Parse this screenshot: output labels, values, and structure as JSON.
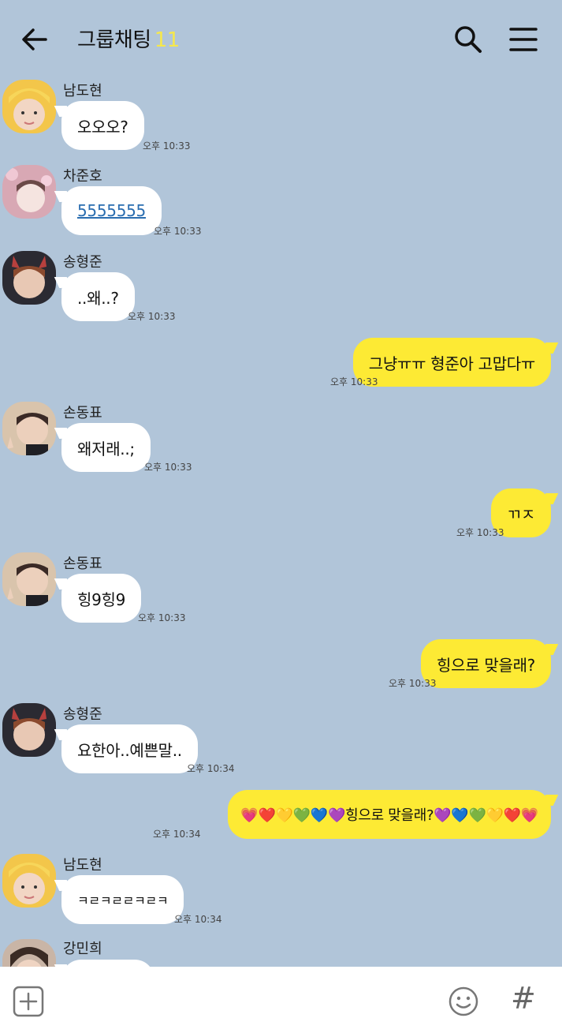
{
  "header": {
    "title": "그룹채팅",
    "member_count": "11",
    "count_color": "#f6e84b"
  },
  "colors": {
    "background": "#b1c5d9",
    "incoming": "#ffffff",
    "outgoing": "#fdea34",
    "link": "#2a6db0"
  },
  "messages": [
    {
      "sender": "남도현",
      "text": "오오오?",
      "time": "오후 10:33",
      "direction": "in",
      "avatar_icon": "chick-hat-avatar"
    },
    {
      "sender": "차준호",
      "text": "5555555",
      "time": "오후 10:33",
      "direction": "in",
      "is_link": true,
      "avatar_icon": "flower-avatar"
    },
    {
      "sender": "송형준",
      "text": "..왜..?",
      "time": "오후 10:33",
      "direction": "in",
      "avatar_icon": "devil-horn-avatar"
    },
    {
      "text": "그냥ㅠㅠ 형준아 고맙다ㅠ",
      "time": "오후 10:33",
      "direction": "out"
    },
    {
      "sender": "손동표",
      "text": "왜저래..;",
      "time": "오후 10:33",
      "direction": "in",
      "avatar_icon": "peace-sign-avatar"
    },
    {
      "text": "ㄲㅈ",
      "time": "오후 10:33",
      "direction": "out"
    },
    {
      "sender": "손동표",
      "text": "힝9힝9",
      "time": "오후 10:33",
      "direction": "in",
      "avatar_icon": "peace-sign-avatar"
    },
    {
      "text": "힝으로 맞을래?",
      "time": "오후 10:33",
      "direction": "out"
    },
    {
      "sender": "송형준",
      "text": "요한아..예쁜말..",
      "time": "오후 10:34",
      "direction": "in",
      "avatar_icon": "devil-horn-avatar"
    },
    {
      "text": "💗❤️💛💚💙💜힝으로 맞을래?💜💙💚💛❤️💗",
      "time": "오후 10:34",
      "direction": "out"
    },
    {
      "sender": "남도현",
      "text": "ㅋㄹㅋㄹㄹㅋㄹㅋ",
      "time": "오후 10:34",
      "direction": "in",
      "avatar_icon": "chick-hat-avatar"
    },
    {
      "sender": "강민희",
      "text": "",
      "time": "",
      "direction": "in",
      "avatar_icon": "person-avatar"
    }
  ],
  "footer": {
    "hash_label": "#"
  }
}
